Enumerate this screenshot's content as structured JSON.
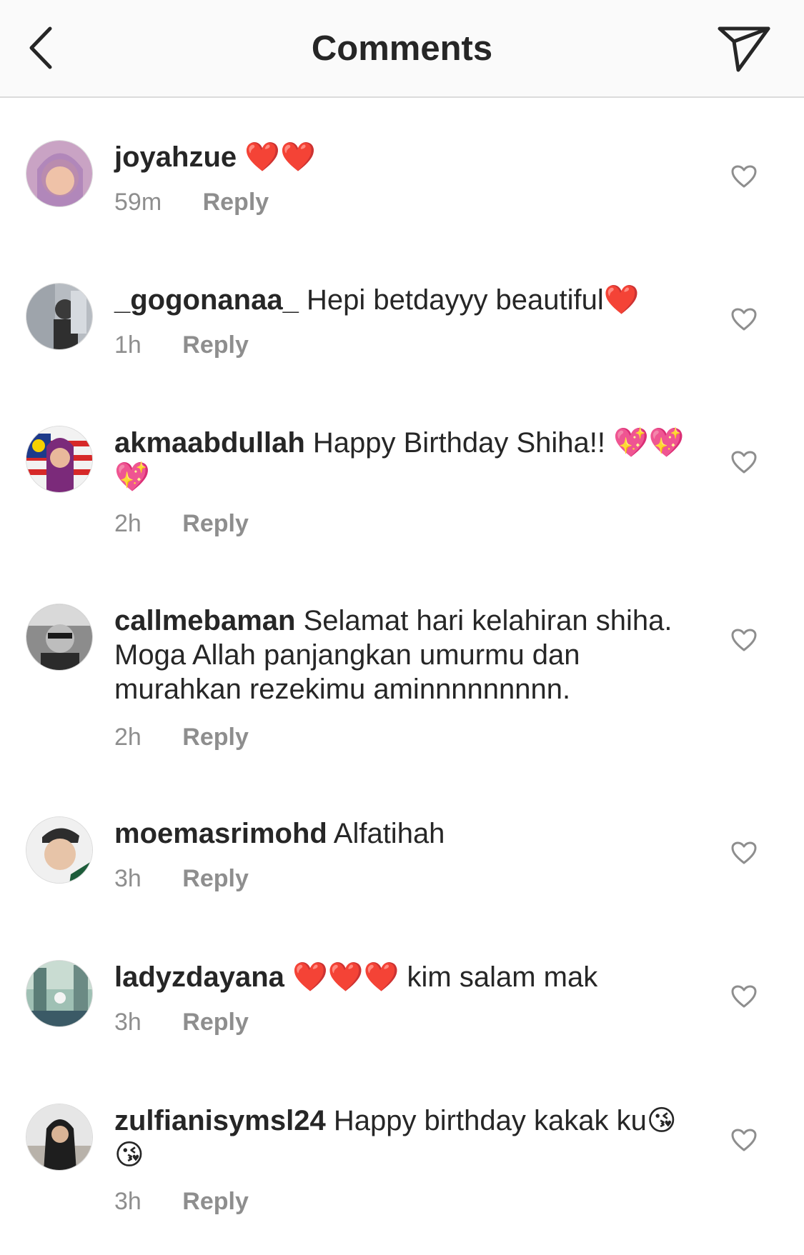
{
  "header": {
    "title": "Comments"
  },
  "comments": [
    {
      "username": "joyahzue",
      "text": "❤️❤️",
      "time": "59m",
      "reply": "Reply"
    },
    {
      "username": "_gogonanaa_",
      "text": "Hepi betdayyy beautiful❤️",
      "time": "1h",
      "reply": "Reply"
    },
    {
      "username": "akmaabdullah",
      "text": "Happy Birthday Shiha!! 💖💖💖",
      "time": "2h",
      "reply": "Reply"
    },
    {
      "username": "callmebaman",
      "text": "Selamat hari kelahiran shiha. Moga Allah panjangkan umurmu dan murahkan rezekimu aminnnnnnnnn.",
      "time": "2h",
      "reply": "Reply"
    },
    {
      "username": "moemasrimohd",
      "text": "Alfatihah",
      "time": "3h",
      "reply": "Reply"
    },
    {
      "username": "ladyzdayana",
      "text": "❤️❤️❤️ kim salam mak",
      "time": "3h",
      "reply": "Reply"
    },
    {
      "username": "zulfianisymsl24",
      "text": "Happy birthday kakak ku😘😘",
      "time": "3h",
      "reply": "Reply"
    }
  ]
}
